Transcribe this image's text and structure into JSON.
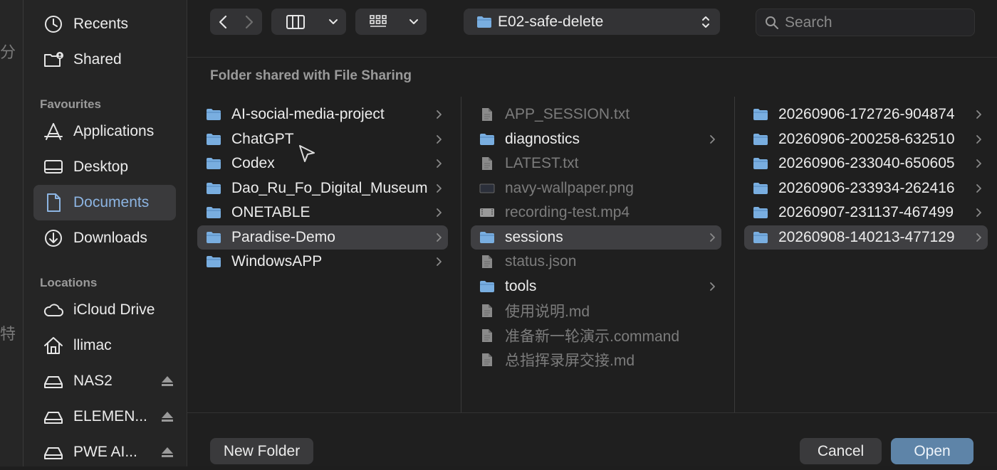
{
  "window": {
    "title": "E02-safe-delete"
  },
  "sidebar": {
    "top_items": [
      {
        "label": "Recents",
        "icon": "clock-icon"
      },
      {
        "label": "Shared",
        "icon": "shared-folder-icon"
      }
    ],
    "favourites_header": "Favourites",
    "favourites": [
      {
        "label": "Applications",
        "icon": "applications-icon"
      },
      {
        "label": "Desktop",
        "icon": "desktop-icon"
      },
      {
        "label": "Documents",
        "icon": "document-icon",
        "selected": true
      },
      {
        "label": "Downloads",
        "icon": "download-icon"
      }
    ],
    "locations_header": "Locations",
    "locations": [
      {
        "label": "iCloud Drive",
        "icon": "cloud-icon"
      },
      {
        "label": "llimac",
        "icon": "home-icon"
      },
      {
        "label": "NAS2",
        "icon": "drive-icon",
        "eject": true
      },
      {
        "label": "ELEMEN...",
        "icon": "drive-icon",
        "eject": true
      },
      {
        "label": "PWE AI...",
        "icon": "drive-icon",
        "eject": true
      }
    ]
  },
  "toolbar": {
    "back_icon": "chevron-left-icon",
    "forward_icon": "chevron-right-icon",
    "view_icon": "column-view-icon",
    "group_icon": "grid-icon",
    "path_label": "E02-safe-delete",
    "search_placeholder": "Search"
  },
  "header": "Folder shared with File Sharing",
  "columns": [
    {
      "items": [
        {
          "label": "AI-social-media-project",
          "type": "folder"
        },
        {
          "label": "ChatGPT",
          "type": "folder"
        },
        {
          "label": "Codex",
          "type": "folder"
        },
        {
          "label": "Dao_Ru_Fo_Digital_Museum",
          "type": "folder"
        },
        {
          "label": "ONETABLE",
          "type": "folder"
        },
        {
          "label": "Paradise-Demo",
          "type": "folder",
          "selected": true
        },
        {
          "label": "WindowsAPP",
          "type": "folder"
        }
      ]
    },
    {
      "items": [
        {
          "label": "APP_SESSION.txt",
          "type": "file"
        },
        {
          "label": "diagnostics",
          "type": "folder"
        },
        {
          "label": "LATEST.txt",
          "type": "file"
        },
        {
          "label": "navy-wallpaper.png",
          "type": "image"
        },
        {
          "label": "recording-test.mp4",
          "type": "video"
        },
        {
          "label": "sessions",
          "type": "folder",
          "selected": true
        },
        {
          "label": "status.json",
          "type": "file"
        },
        {
          "label": "tools",
          "type": "folder"
        },
        {
          "label": "使用说明.md",
          "type": "file"
        },
        {
          "label": "准备新一轮演示.command",
          "type": "file"
        },
        {
          "label": "总指挥录屏交接.md",
          "type": "file"
        }
      ]
    },
    {
      "items": [
        {
          "label": "20260906-172726-904874",
          "type": "folder"
        },
        {
          "label": "20260906-200258-632510",
          "type": "folder"
        },
        {
          "label": "20260906-233040-650605",
          "type": "folder"
        },
        {
          "label": "20260906-233934-262416",
          "type": "folder"
        },
        {
          "label": "20260907-231137-467499",
          "type": "folder"
        },
        {
          "label": "20260908-140213-477129",
          "type": "folder",
          "selected": true
        }
      ]
    }
  ],
  "buttons": {
    "new_folder": "New Folder",
    "cancel": "Cancel",
    "open": "Open"
  },
  "colors": {
    "accent": "#5e84a8",
    "selected_sidebar_text": "#8cb4e2",
    "folder": "#79aee0",
    "selection": "#3f3f42"
  }
}
